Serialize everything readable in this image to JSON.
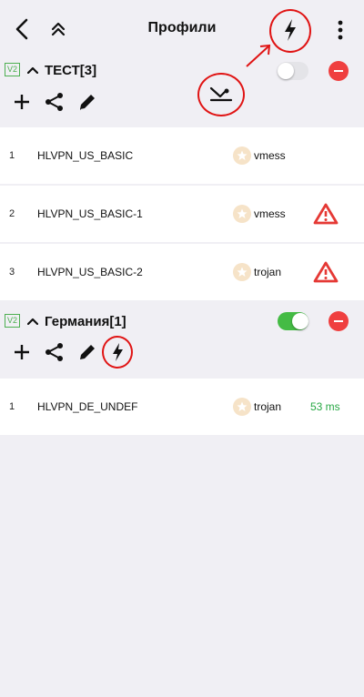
{
  "header": {
    "title": "Профили"
  },
  "icons": {
    "back": "chevron-left-icon",
    "collapse_all": "double-chevron-up-icon",
    "speed_test": "lightning-icon",
    "more": "more-vertical-icon",
    "add": "plus-icon",
    "share": "share-icon",
    "edit": "pencil-icon",
    "move_down": "move-down-icon",
    "warning": "warning-icon",
    "protocol": "star-badge-icon"
  },
  "groups": [
    {
      "badge": "V2",
      "name": "ТЕСТ[3]",
      "enabled": false,
      "profiles": [
        {
          "index": "1",
          "name": "HLVPN_US_BASIC",
          "protocol": "vmess",
          "status": ""
        },
        {
          "index": "2",
          "name": "HLVPN_US_BASIC-1",
          "protocol": "vmess",
          "status": "warning"
        },
        {
          "index": "3",
          "name": "HLVPN_US_BASIC-2",
          "protocol": "trojan",
          "status": "warning"
        }
      ]
    },
    {
      "badge": "V2",
      "name": "Германия[1]",
      "enabled": true,
      "profiles": [
        {
          "index": "1",
          "name": "HLVPN_DE_UNDEF",
          "protocol": "trojan",
          "latency": "53 ms"
        }
      ]
    }
  ],
  "colors": {
    "background": "#f0eff4",
    "annotation_red": "#e01414",
    "toggle_on": "#44bb44",
    "remove_red": "#ef3f3f",
    "warning_red": "#e53935",
    "latency_green": "#27a844",
    "v2_green": "#4caf50"
  }
}
